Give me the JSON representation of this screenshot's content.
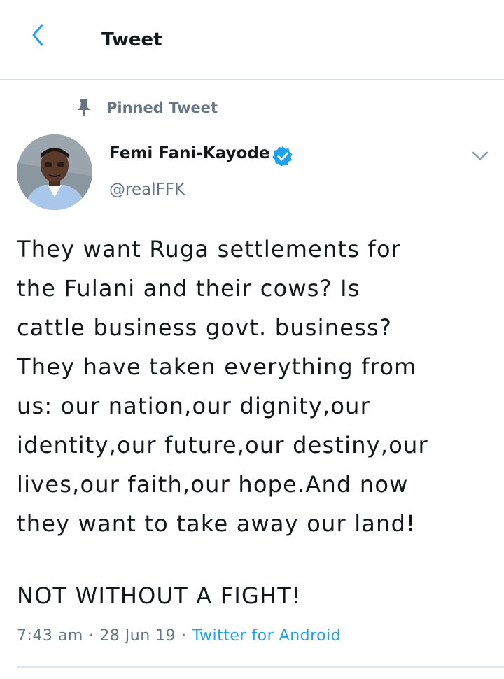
{
  "header": {
    "title": "Tweet",
    "back_icon": "arrow-left-icon"
  },
  "pinned": {
    "icon": "pin-icon",
    "label": "Pinned Tweet"
  },
  "author": {
    "name": "Femi Fani-Kayode",
    "handle": "@realFFK",
    "verified": true
  },
  "tweet": {
    "lines": [
      "They want Ruga settlements for",
      "the Fulani and their cows? Is",
      "cattle business govt. business?",
      "They have taken everything from",
      "us: our nation,our dignity,our",
      "identity,our future,our destiny,our",
      "lives,our faith,our hope.And now",
      "they want to take away our land!"
    ],
    "closing": "NOT WITHOUT A FIGHT!",
    "time": "7:43 am",
    "date": "28 Jun 19",
    "separator": "·",
    "source": "Twitter for Android"
  },
  "colors": {
    "accent": "#1da1f2",
    "secondary_text": "#657786",
    "primary_text": "#14171a"
  }
}
